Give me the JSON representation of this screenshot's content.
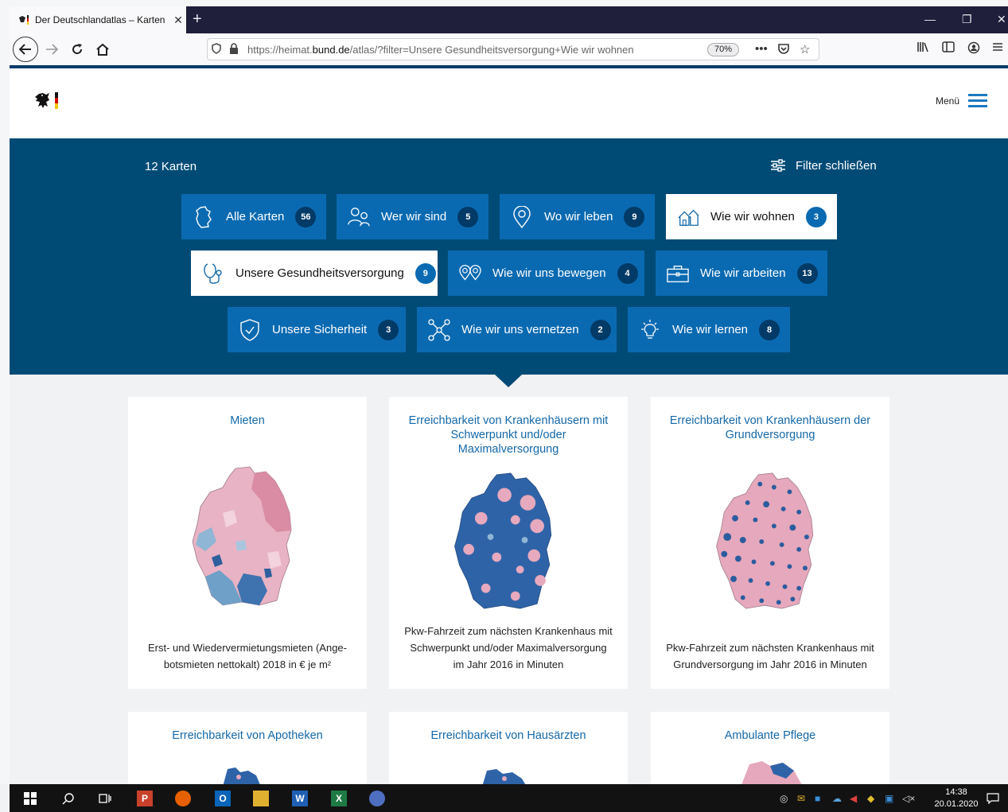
{
  "browser": {
    "tab_title": "Der Deutschlandatlas – Karten",
    "tab_close": "✕",
    "new_tab": "+",
    "url_prefix": "https://heimat.",
    "url_domain": "bund.de",
    "url_suffix": "/atlas/?filter=Unsere Gesundheitsversorgung+Wie wir wohnen",
    "zoom": "70%",
    "page_actions": "•••"
  },
  "header": {
    "menu_label": "Menü"
  },
  "filter": {
    "count_label": "12 Karten",
    "close_label": "Filter schließen",
    "categories": [
      {
        "label": "Alle Karten",
        "count": "56",
        "icon": "germany-outline-icon",
        "active": false
      },
      {
        "label": "Wer wir sind",
        "count": "5",
        "icon": "people-icon",
        "active": false
      },
      {
        "label": "Wo wir leben",
        "count": "9",
        "icon": "location-pin-icon",
        "active": false
      },
      {
        "label": "Wie wir wohnen",
        "count": "3",
        "icon": "houses-icon",
        "active": true
      },
      {
        "label": "Unsere Gesundheitsversorgung",
        "count": "9",
        "icon": "stethoscope-icon",
        "active": true
      },
      {
        "label": "Wie wir uns bewegen",
        "count": "4",
        "icon": "route-pins-icon",
        "active": false
      },
      {
        "label": "Wie wir arbeiten",
        "count": "13",
        "icon": "briefcase-icon",
        "active": false
      },
      {
        "label": "Unsere Sicherheit",
        "count": "3",
        "icon": "shield-check-icon",
        "active": false
      },
      {
        "label": "Wie wir uns vernetzen",
        "count": "2",
        "icon": "network-icon",
        "active": false
      },
      {
        "label": "Wie wir lernen",
        "count": "8",
        "icon": "lightbulb-icon",
        "active": false
      }
    ]
  },
  "cards": [
    {
      "title": "Mieten",
      "description_1": "Erst- und Wiedervermietungsmieten (Ange-",
      "description_2": "botsmieten nettokalt) 2018 in € je m²"
    },
    {
      "title": "Erreichbarkeit von Krankenhäusern mit Schwerpunkt und/oder Maximalversorgung",
      "description_1": "Pkw-Fahrzeit zum nächsten Krankenhaus mit",
      "description_2": "Schwerpunkt und/oder Maximalversorgung",
      "description_3": "im Jahr 2016 in Minuten"
    },
    {
      "title": "Erreichbarkeit von Krankenhäusern der Grundversorgung",
      "description_1": "Pkw-Fahrzeit zum nächsten Krankenhaus mit",
      "description_2": "Grundversorgung im Jahr 2016 in Minuten"
    },
    {
      "title": "Erreichbarkeit von Apotheken"
    },
    {
      "title": "Erreichbarkeit von Hausärzten"
    },
    {
      "title": "Ambulante Pflege"
    }
  ],
  "taskbar": {
    "time": "14:38",
    "date": "20.01.2020"
  },
  "colors": {
    "panel": "#004b76",
    "chip": "#0a6ab1",
    "badge": "#003a66",
    "link": "#1468a8",
    "map_pink": "#e3a6b8",
    "map_blue": "#2a5c9e"
  }
}
